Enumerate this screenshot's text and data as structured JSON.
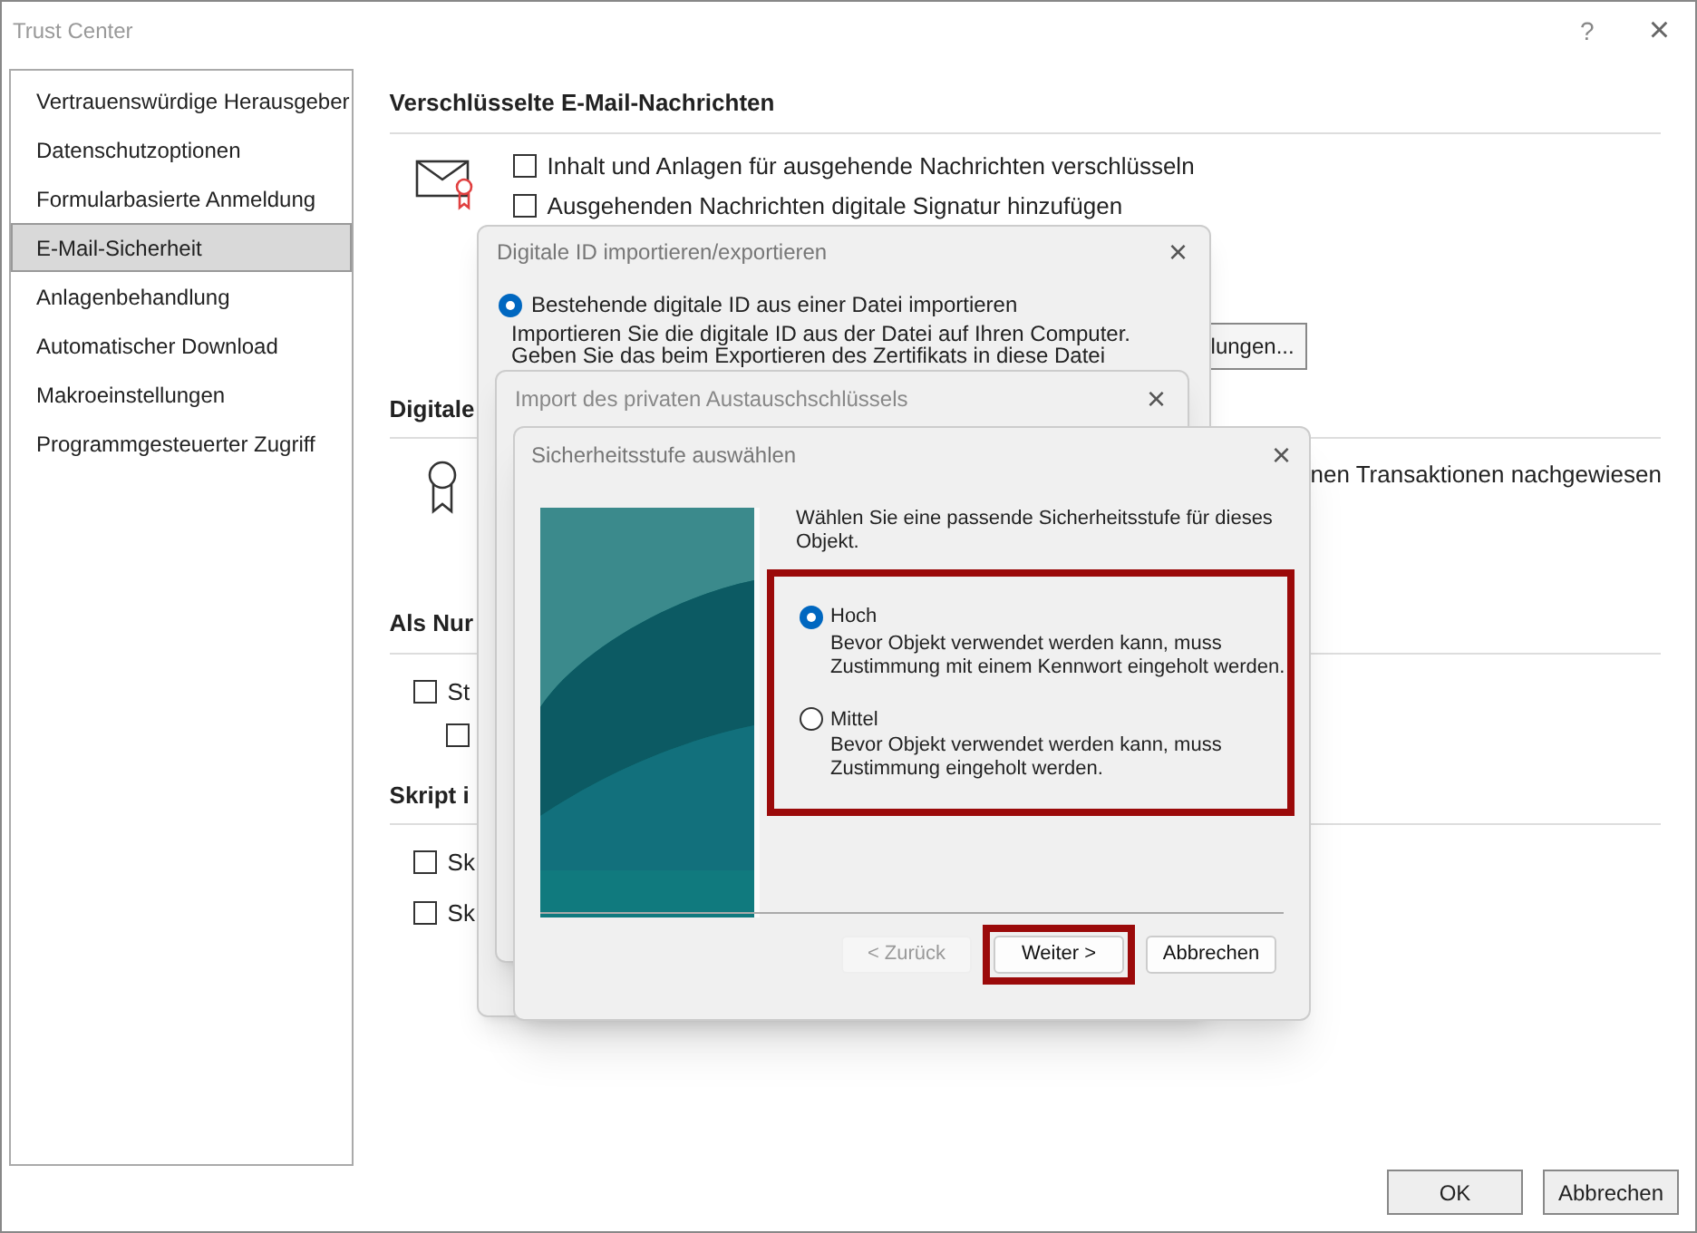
{
  "window": {
    "title": "Trust Center",
    "help": "?",
    "close": "×"
  },
  "sidebar": {
    "items": [
      {
        "label": "Vertrauenswürdige Herausgeber",
        "selected": false
      },
      {
        "label": "Datenschutzoptionen",
        "selected": false
      },
      {
        "label": "Formularbasierte Anmeldung",
        "selected": false
      },
      {
        "label": "E-Mail-Sicherheit",
        "selected": true
      },
      {
        "label": "Anlagenbehandlung",
        "selected": false
      },
      {
        "label": "Automatischer Download",
        "selected": false
      },
      {
        "label": "Makroeinstellungen",
        "selected": false
      },
      {
        "label": "Programmgesteuerter Zugriff",
        "selected": false
      }
    ]
  },
  "encrypted": {
    "heading": "Verschlüsselte E-Mail-Nachrichten",
    "options": [
      {
        "label": "Inhalt und Anlagen für ausgehende Nachrichten verschlüsseln",
        "checked": false
      },
      {
        "label": "Ausgehenden Nachrichten digitale Signatur hinzufügen",
        "checked": false
      }
    ],
    "button": "lungen..."
  },
  "digital": {
    "heading": "Digitale",
    "text": "nen Transaktionen nachgewiesen"
  },
  "plain": {
    "heading": "Als Nur",
    "options": [
      {
        "label": "St",
        "checked": false
      },
      {
        "checked": false
      }
    ]
  },
  "script": {
    "heading": "Skript i",
    "options": [
      {
        "label": "Sk",
        "checked": false
      },
      {
        "label": "Sk",
        "checked": false
      }
    ]
  },
  "footer": {
    "buttons": [
      "OK",
      "Abbrechen"
    ]
  },
  "dialog_export": {
    "title": "Digitale ID importieren/exportieren",
    "close": "×",
    "option": {
      "label": "Bestehende digitale ID aus einer Datei importieren",
      "selected": true
    },
    "lines": [
      "Importieren Sie die digitale ID aus der Datei auf Ihren Computer.",
      "Geben Sie das beim Exportieren des Zertifikats in diese Datei"
    ]
  },
  "dialog_import": {
    "title": "Import des privaten Austauschschlüssels",
    "close": "×"
  },
  "dialog_level": {
    "title": "Sicherheitsstufe auswählen",
    "close": "×",
    "prompt": "Wählen Sie eine passende Sicherheitsstufe für dieses Objekt.",
    "highlighted": true,
    "levels": [
      {
        "label": "Hoch",
        "description": "Bevor Objekt verwendet werden kann, muss Zustimmung mit einem Kennwort eingeholt werden.",
        "selected": true
      },
      {
        "label": "Mittel",
        "description": "Bevor Objekt verwendet werden kann, muss Zustimmung eingeholt werden.",
        "selected": false
      }
    ],
    "buttons": [
      {
        "label": "< Zurück",
        "disabled": true,
        "highlighted": false
      },
      {
        "label": "Weiter >",
        "disabled": false,
        "highlighted": true
      },
      {
        "label": "Abbrechen",
        "disabled": false,
        "highlighted": false
      }
    ]
  }
}
